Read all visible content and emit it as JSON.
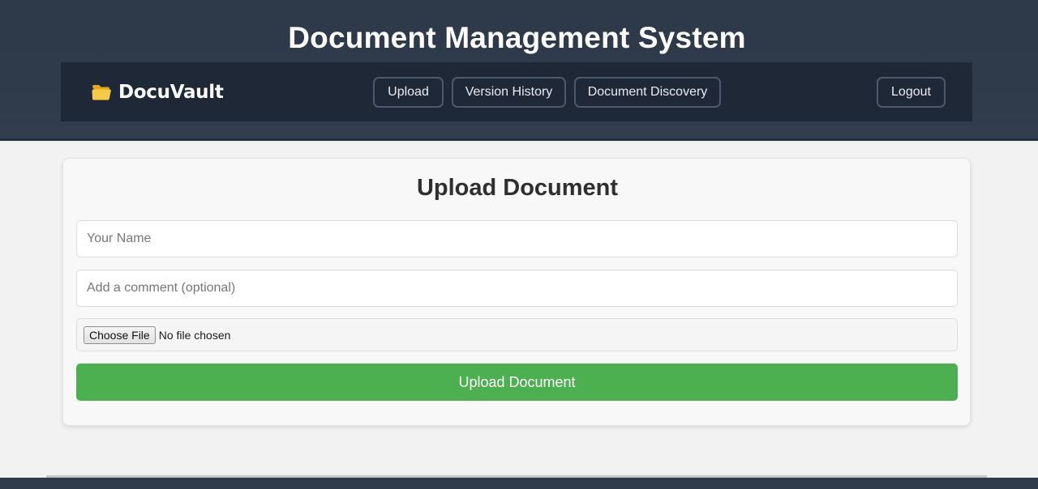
{
  "header": {
    "title": "Document Management System"
  },
  "navbar": {
    "brand": "DocuVault",
    "brand_icon": "folder-icon",
    "items": [
      {
        "label": "Upload"
      },
      {
        "label": "Version History"
      },
      {
        "label": "Document Discovery"
      }
    ],
    "logout_label": "Logout"
  },
  "upload_form": {
    "title": "Upload Document",
    "name_placeholder": "Your Name",
    "name_value": "",
    "comment_placeholder": "Add a comment (optional)",
    "comment_value": "",
    "file_button_label": "Choose File",
    "file_status": "No file chosen",
    "submit_label": "Upload Document"
  },
  "colors": {
    "header_bg": "#2f3b4b",
    "navbar_bg": "#1f2837",
    "submit_green": "#4caf50",
    "folder_yellow": "#f5c542"
  }
}
